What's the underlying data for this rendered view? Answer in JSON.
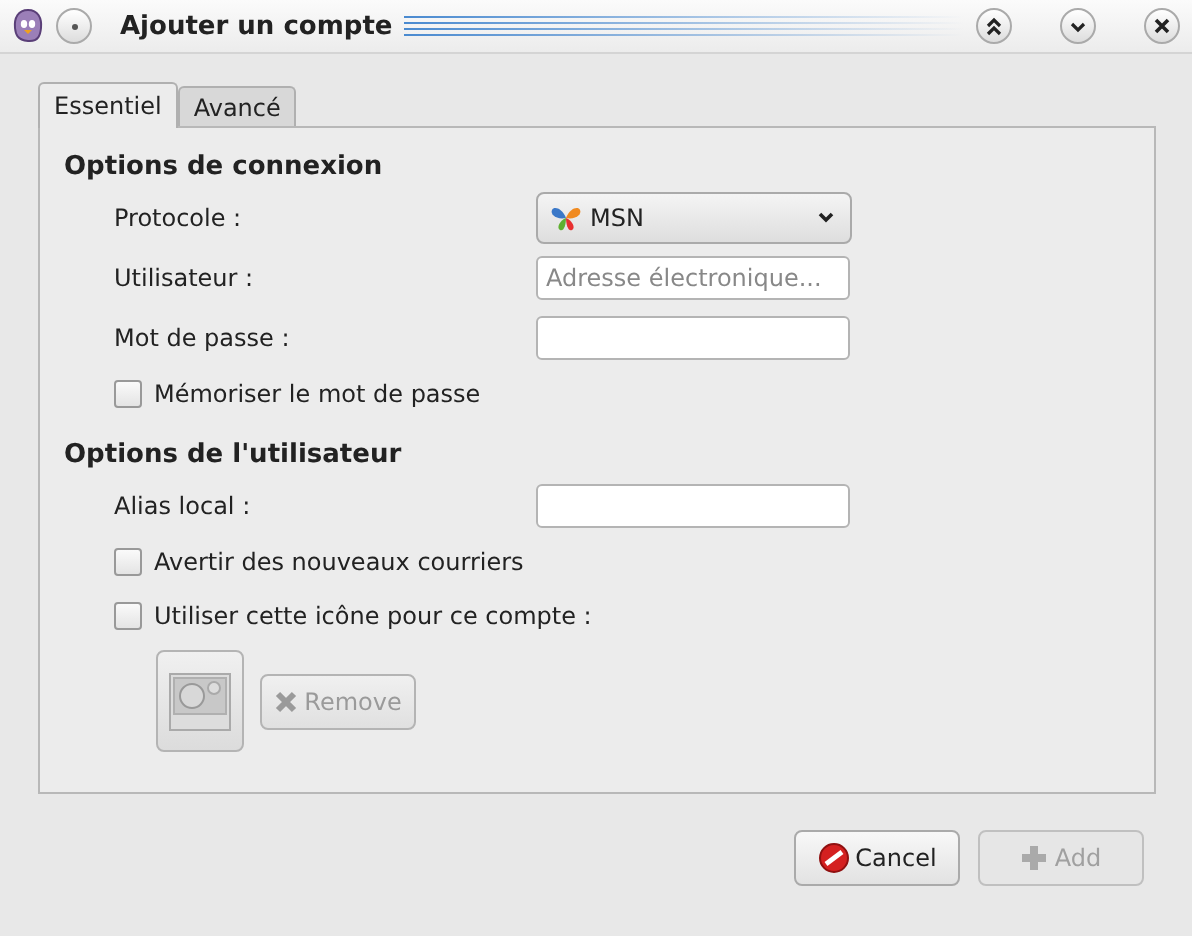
{
  "window": {
    "title": "Ajouter un compte"
  },
  "tabs": [
    {
      "label": "Essentiel",
      "selected": true
    },
    {
      "label": "Avancé",
      "selected": false
    }
  ],
  "sections": [
    {
      "title": "Options de connexion",
      "rows": [
        {
          "kind": "select",
          "label": "Protocole :",
          "value": "MSN"
        },
        {
          "kind": "text",
          "label": "Utilisateur :",
          "placeholder": "Adresse électronique..."
        },
        {
          "kind": "text",
          "label": "Mot de passe :"
        },
        {
          "kind": "checkbox",
          "label": "Mémoriser le mot de passe",
          "checked": false
        }
      ]
    },
    {
      "title": "Options de l'utilisateur",
      "rows": [
        {
          "kind": "text",
          "label": "Alias local :"
        },
        {
          "kind": "checkbox",
          "label": "Avertir des nouveaux courriers",
          "checked": false
        },
        {
          "kind": "checkbox",
          "label": "Utiliser cette icône pour ce compte :",
          "checked": false
        },
        {
          "kind": "icon",
          "remove_label": "Remove",
          "disabled": true
        }
      ]
    }
  ],
  "buttons": [
    {
      "kind": "cancel",
      "label": "Cancel",
      "disabled": false
    },
    {
      "kind": "add",
      "label": "Add",
      "disabled": true
    }
  ]
}
